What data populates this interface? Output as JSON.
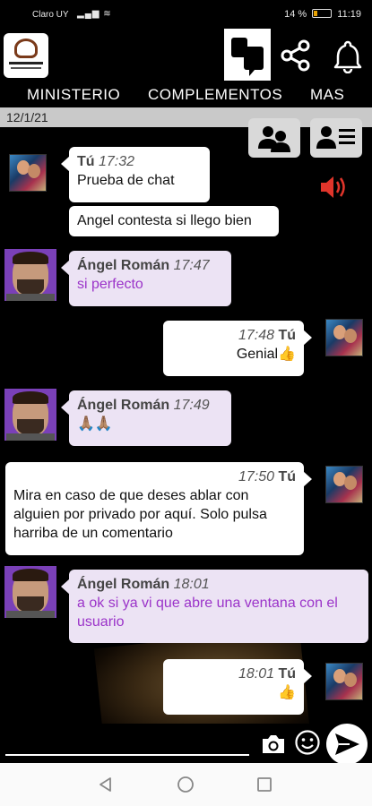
{
  "status_bar": {
    "carrier": "Claro UY",
    "battery_text": "14 %",
    "time": "11:19"
  },
  "tabs": [
    {
      "label": "MINISTERIO"
    },
    {
      "label": "COMPLEMENTOS"
    },
    {
      "label": "MAS"
    }
  ],
  "date_label": "12/1/21",
  "messages": [
    {
      "author": "Tú",
      "time": "17:32",
      "text": "Prueba de chat"
    },
    {
      "author": "",
      "time": "",
      "text": "Angel contesta si llego bien"
    },
    {
      "author": "Ángel Román",
      "time": "17:47",
      "text": "si perfecto"
    },
    {
      "author": "Tú",
      "time": "17:48",
      "text": "Genial👍"
    },
    {
      "author": "Ángel Román",
      "time": "17:49",
      "text": "🙏🏽🙏🏽"
    },
    {
      "author": "Tú",
      "time": "17:50",
      "text": "Mira en caso de que deses ablar con alguien por privado por aquí. Solo pulsa harriba de un comentario"
    },
    {
      "author": "Ángel Román",
      "time": "18:01",
      "text": "a ok si ya vi que abre una ventana con el usuario"
    },
    {
      "author": "Tú",
      "time": "18:01",
      "text": "👍"
    }
  ],
  "input": {
    "value": "",
    "placeholder": ""
  },
  "colors": {
    "received_bubble": "#ece3f4",
    "sent_bubble": "#ffffff",
    "received_text": "#9b34c9",
    "speaker": "#e0352b",
    "avatar_border": "#7a40b8"
  },
  "icons": [
    "chat-icon",
    "share-icon",
    "bell-icon",
    "group-icon",
    "user-list-icon",
    "speaker-icon",
    "camera-icon",
    "emoji-icon",
    "send-icon",
    "back-icon",
    "home-icon",
    "recents-icon"
  ]
}
